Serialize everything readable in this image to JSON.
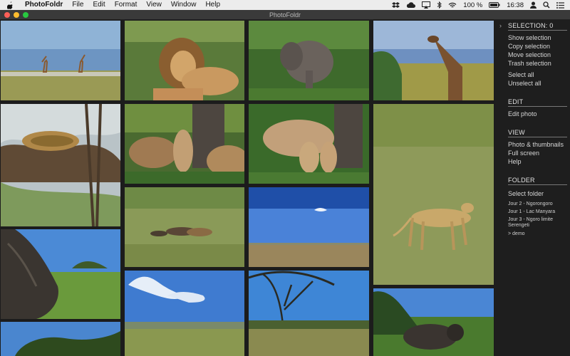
{
  "menubar": {
    "app_name": "PhotoFoldr",
    "menus": [
      "File",
      "Edit",
      "Format",
      "View",
      "Window",
      "Help"
    ],
    "battery": "100 %",
    "clock": "16:38"
  },
  "window": {
    "title": "PhotoFoldr"
  },
  "sidebar": {
    "selection_header": "SELECTION: 0",
    "selection_items": [
      "Show selection",
      "Copy selection",
      "Move selection",
      "Trash selection"
    ],
    "select_items": [
      "Select all",
      "Unselect all"
    ],
    "edit_header": "EDIT",
    "edit_items": [
      "Edit photo"
    ],
    "view_header": "VIEW",
    "view_items": [
      "Photo & thumbnails",
      "Full screen",
      "Help"
    ],
    "folder_header": "FOLDER",
    "select_folder": "Select folder",
    "folders": [
      "Jour 2 - Ngorongoro",
      "Jour 1 - Lac Manyara",
      "Jour 3 - Ngoro limite Serengeti",
      "> demo"
    ]
  },
  "photos": [
    {
      "id": "giraffes-lake"
    },
    {
      "id": "lion"
    },
    {
      "id": "elephant"
    },
    {
      "id": "giraffe-closeup"
    },
    {
      "id": "leopard-tree"
    },
    {
      "id": "lion-cubs"
    },
    {
      "id": "lioness-cubs"
    },
    {
      "id": "cheetah"
    },
    {
      "id": "lions-grass"
    },
    {
      "id": "plain-blue-sky"
    },
    {
      "id": "tree-trunk"
    },
    {
      "id": "clouds-savanna"
    },
    {
      "id": "acacia-tree"
    },
    {
      "id": "buffalo"
    },
    {
      "id": "tree-sky"
    }
  ]
}
